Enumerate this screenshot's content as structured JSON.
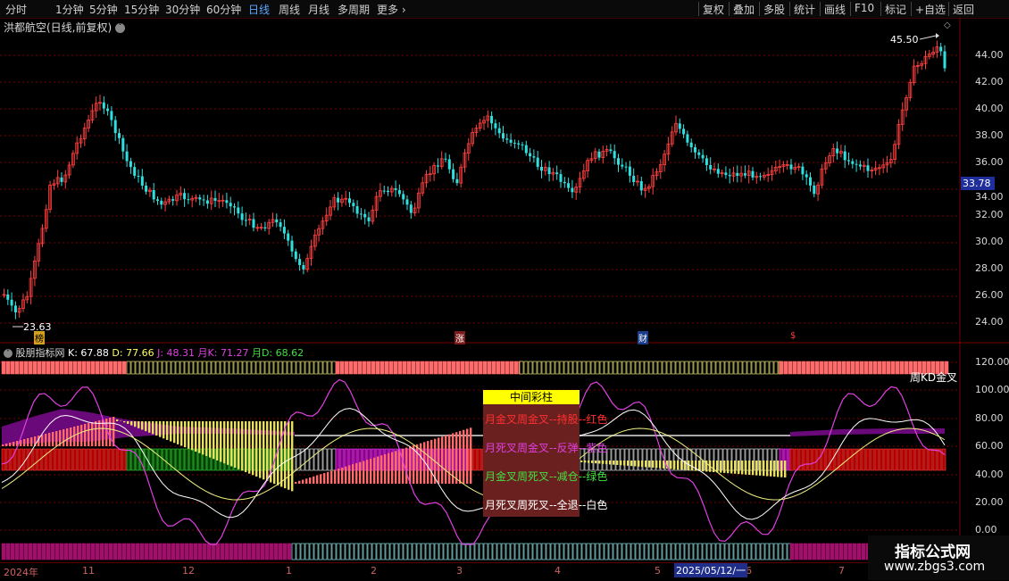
{
  "toolbar": {
    "periods": [
      "分时",
      "1分钟",
      "5分钟",
      "15分钟",
      "30分钟",
      "60分钟",
      "日线",
      "周线",
      "月线",
      "多周期"
    ],
    "active_period": "日线",
    "more": "更多",
    "right_buttons": [
      "复权",
      "叠加",
      "多股",
      "统计",
      "画线",
      "F10",
      "标记",
      "+自选",
      "返回"
    ]
  },
  "price_panel": {
    "title": "洪都航空(日线,前复权)",
    "high_marker": "45.50",
    "low_marker": "23.63",
    "current_price": "33.78",
    "axis_labels": [
      "44.00",
      "42.00",
      "40.00",
      "38.00",
      "36.00",
      "34.00",
      "32.00",
      "30.00",
      "28.00",
      "26.00",
      "24.00"
    ],
    "event_tags": [
      "榜",
      "涨",
      "财",
      "$"
    ]
  },
  "indicator_panel": {
    "name": "股朋指标网",
    "k": "K: 67.88",
    "d": "D: 77.66",
    "j": "J: 48.31",
    "mk": "月K: 71.27",
    "md": "月D: 68.62",
    "axis_labels": [
      "120.00",
      "100.00",
      "80.00",
      "60.00",
      "40.00",
      "20.00",
      "0.00"
    ],
    "zhou_kd": "周KD金叉"
  },
  "legend": {
    "title": "中间彩柱",
    "lines": [
      "月金叉周金叉--持股--红色",
      "月死叉周金叉--反弹--紫色",
      "月金叉周死叉--减仓--绿色",
      "月死叉周死叉--全退--白色"
    ]
  },
  "timeline": {
    "labels": [
      "2024年",
      "11",
      "12",
      "1",
      "2",
      "3",
      "4",
      "5",
      "6",
      "7"
    ],
    "cursor_date": "2025/05/12/一"
  },
  "watermark": {
    "line1": "指标公式网",
    "line2": "www.zbgs3.com"
  },
  "colors": {
    "up": "#ff4040",
    "down": "#2fe0e0",
    "grid": "#7a0000",
    "legend_bg": "#6b2020",
    "red_text": "#ff3030",
    "purple_text": "#e040e0",
    "green_text": "#40e040",
    "white_text": "#ffffff"
  }
}
